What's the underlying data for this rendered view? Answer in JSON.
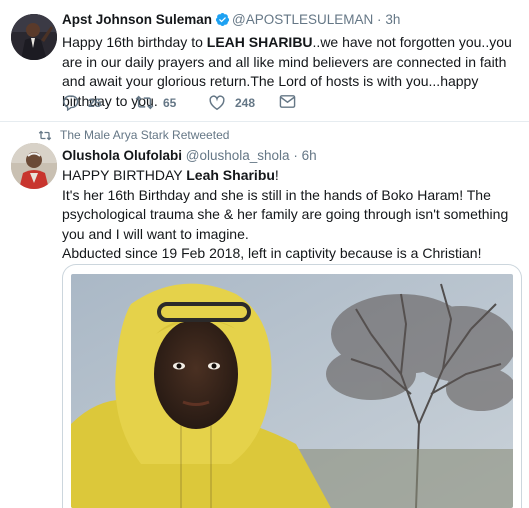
{
  "tweets": [
    {
      "author_name": "Apst Johnson Suleman",
      "handle": "@APOSTLESULEMAN",
      "separator": "·",
      "time": "3h",
      "text_pre": "Happy 16th birthday to ",
      "text_bold": "LEAH SHARIBU",
      "text_post": "..we have not forgotten you..you are in our daily prayers and all like mind believers are connected in faith and await your glorious return.The Lord of hosts is with you...happy birthday to you.",
      "replies": "25",
      "retweets": "65",
      "likes": "248"
    },
    {
      "retweeted_by": "The Male Arya Stark Retweeted",
      "author_name": "Olushola Olufolabi",
      "handle": "@olushola_shola",
      "separator": "·",
      "time": "6h",
      "line1_pre": "HAPPY BIRTHDAY ",
      "line1_bold": "Leah Sharibu",
      "line1_post": "!",
      "line2": "It's her 16th Birthday and she is still in the hands of Boko Haram! The psychological trauma she & her family are going through isn't something you and I will want to imagine.",
      "line3": "Abducted since 19 Feb 2018, left in captivity because is a Christian!"
    }
  ],
  "colors": {
    "text": "#14171a",
    "muted": "#657786",
    "verified": "#1da1f2",
    "divider": "#e6ecf0"
  },
  "icons": [
    "verified-badge-icon",
    "reply-icon",
    "retweet-icon",
    "like-icon",
    "direct-message-icon",
    "retweet-small-icon"
  ]
}
